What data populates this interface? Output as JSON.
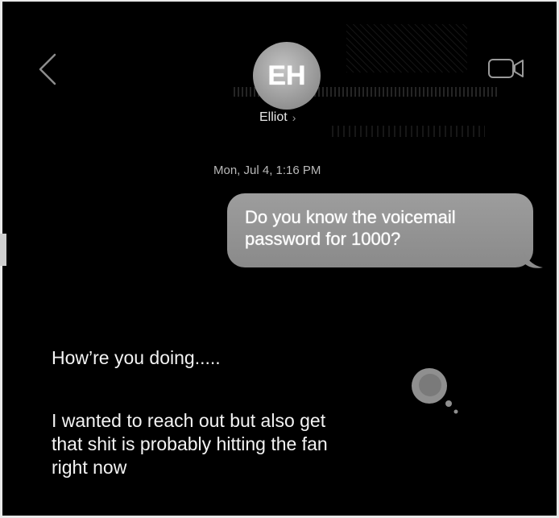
{
  "header": {
    "back_icon": "chevron-left-icon",
    "avatar_initials": "EH",
    "contact_name": "Elliot",
    "contact_chevron": "›",
    "video_icon": "video-camera-icon"
  },
  "conversation": {
    "timestamp": "Mon, Jul 4, 1:16 PM",
    "sent_message": {
      "line1": "Do you know the voicemail",
      "line2": "password for 1000?"
    },
    "received_messages": [
      {
        "text": "How’re you doing....."
      },
      {
        "lines": [
          "I wanted to reach out but also get",
          "that shit is probably hitting the fan",
          "right now"
        ]
      }
    ],
    "typing_indicator_icon": "thinking-bubble-icon"
  },
  "colors": {
    "background": "#000000",
    "sent_bubble": "#9a9a9a",
    "timestamp": "#b9b9b9",
    "frame": "#e9e9e9"
  }
}
